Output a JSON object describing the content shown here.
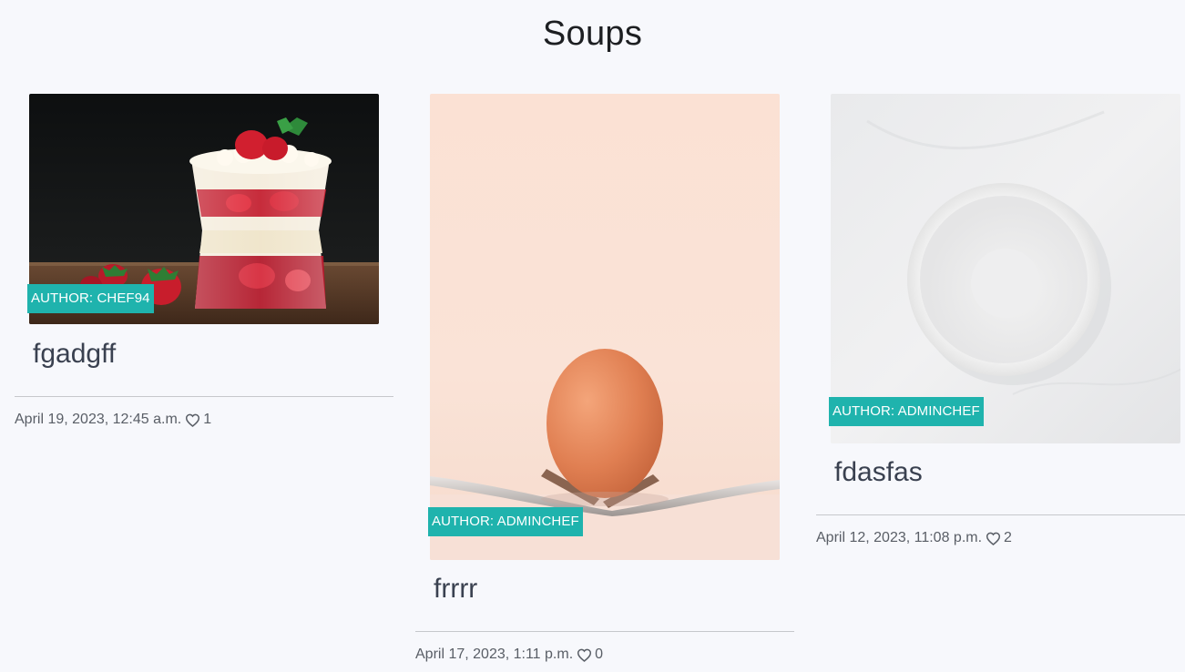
{
  "page": {
    "title": "Soups"
  },
  "recipes": [
    {
      "title": "fgadgff",
      "author_badge": "AUTHOR: CHEF94",
      "date": "April 19, 2023, 12:45 a.m.",
      "likes": "1",
      "image": "strawberry-parfait-photo"
    },
    {
      "title": "frrrr",
      "author_badge": "AUTHOR: ADMINCHEF",
      "date": "April 17, 2023, 1:11 p.m.",
      "likes": "0",
      "image": "egg-on-forks-photo"
    },
    {
      "title": "fdasfas",
      "author_badge": "AUTHOR: ADMINCHEF",
      "date": "April 12, 2023, 11:08 p.m.",
      "likes": "2",
      "image": "white-bowl-photo"
    }
  ],
  "colors": {
    "background": "#f7f8fc",
    "badge": "#1fb3ad",
    "title_text": "#3a4150",
    "meta_text": "#595e66"
  },
  "icons": {
    "like": "heart-outline-icon"
  }
}
